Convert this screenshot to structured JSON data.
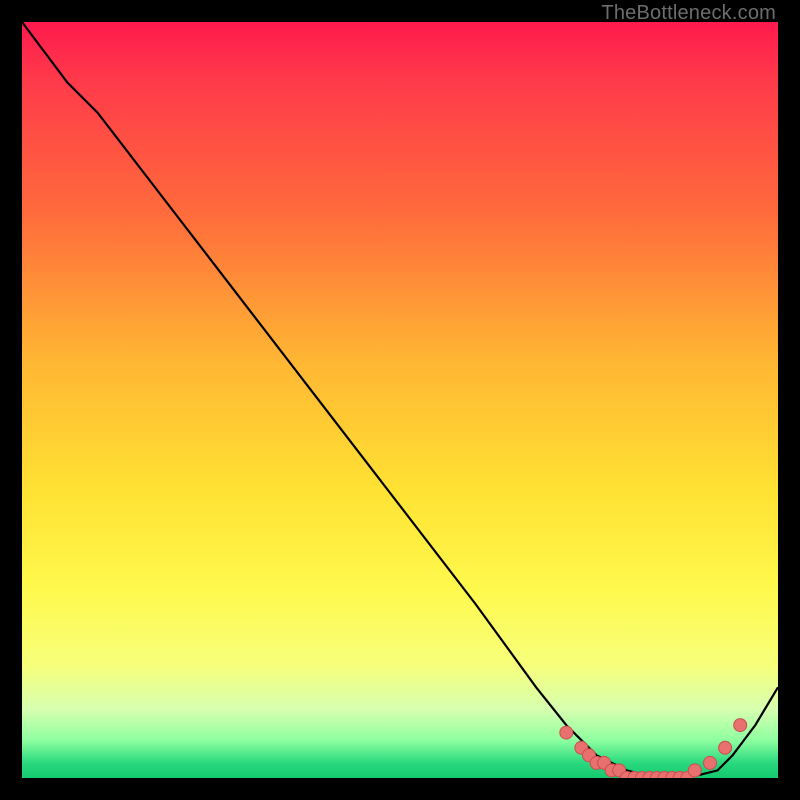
{
  "watermark": "TheBottleneck.com",
  "colors": {
    "background": "#000000",
    "curve_stroke": "#000000",
    "marker_fill": "#e8706f",
    "marker_stroke": "#c94f4e"
  },
  "chart_data": {
    "type": "line",
    "title": "",
    "xlabel": "",
    "ylabel": "",
    "xlim": [
      0,
      100
    ],
    "ylim": [
      0,
      100
    ],
    "grid": false,
    "legend": false,
    "note": "Axes have no visible tick labels; x and y are normalized 0–100 based on plot extent.",
    "series": [
      {
        "name": "curve",
        "x": [
          0,
          6,
          10,
          20,
          30,
          40,
          50,
          60,
          68,
          72,
          76,
          80,
          84,
          88,
          92,
          94,
          97,
          100
        ],
        "y": [
          100,
          92,
          88,
          75,
          62,
          49,
          36,
          23,
          12,
          7,
          3,
          1,
          0,
          0,
          1,
          3,
          7,
          12
        ]
      }
    ],
    "markers": {
      "name": "flat-region-dots",
      "x": [
        72,
        74,
        75,
        76,
        77,
        78,
        79,
        80,
        81,
        82,
        83,
        84,
        85,
        86,
        87,
        88,
        89,
        91,
        93,
        95
      ],
      "y": [
        6,
        4,
        3,
        2,
        2,
        1,
        1,
        0,
        0,
        0,
        0,
        0,
        0,
        0,
        0,
        0,
        1,
        2,
        4,
        7
      ]
    }
  }
}
